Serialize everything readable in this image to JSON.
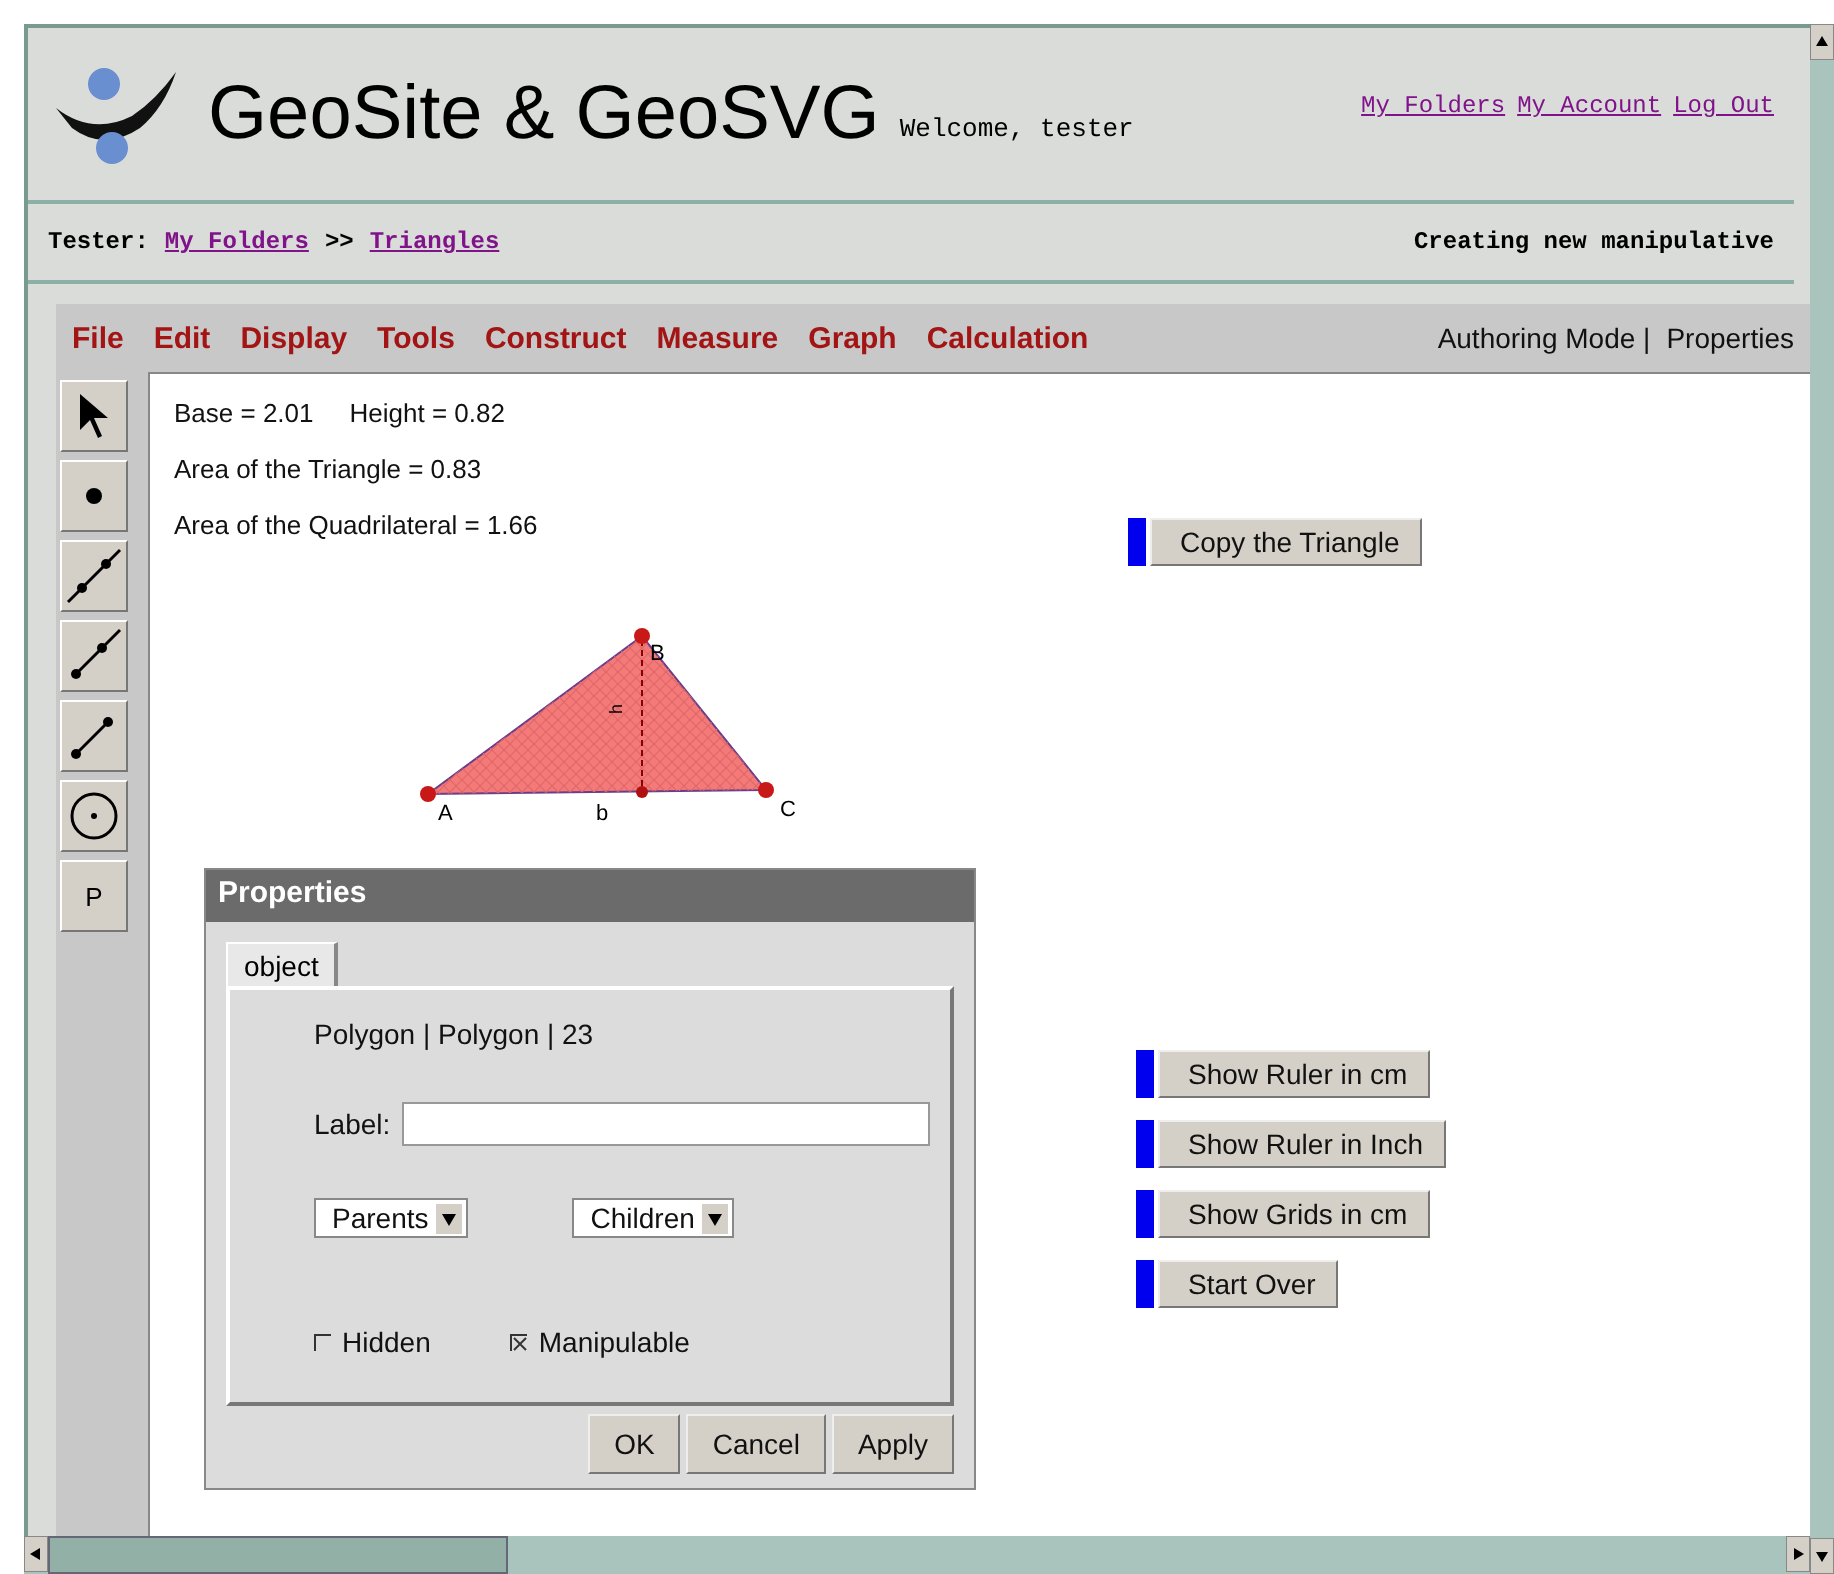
{
  "header": {
    "title": "GeoSite & GeoSVG",
    "welcome": "Welcome, tester",
    "links": [
      "My Folders",
      "My Account",
      "Log Out"
    ]
  },
  "breadcrumb": {
    "label": "Tester:",
    "links": [
      "My Folders",
      "Triangles"
    ],
    "separator": ">>",
    "status": "Creating new manipulative"
  },
  "menu": [
    "File",
    "Edit",
    "Display",
    "Tools",
    "Construct",
    "Measure",
    "Graph",
    "Calculation"
  ],
  "mode_links": [
    "Authoring Mode |",
    "Properties"
  ],
  "tools": [
    {
      "kind": "arrow"
    },
    {
      "kind": "point"
    },
    {
      "kind": "line"
    },
    {
      "kind": "ray"
    },
    {
      "kind": "segment"
    },
    {
      "kind": "circle"
    },
    {
      "kind": "text",
      "label": "P"
    }
  ],
  "measurements": [
    [
      "Base = 2.01",
      "Height = 0.82"
    ],
    [
      "Area of the Triangle = 0.83"
    ],
    [
      "Area of the Quadrilateral = 1.66"
    ]
  ],
  "figure": {
    "vertices": [
      "A",
      "B",
      "C"
    ],
    "side_label": "b",
    "height_label": "h"
  },
  "dialog": {
    "title": "Properties",
    "tabs": [
      {
        "label": "object",
        "selected": true
      }
    ],
    "info": "Polygon | Polygon | 23",
    "label_field": {
      "label": "Label:"
    },
    "dropdowns": [
      "Parents",
      "Children"
    ],
    "checkboxes": [
      {
        "label": "Hidden",
        "checked": false
      },
      {
        "label": "Manipulable",
        "checked": true
      }
    ],
    "buttons": [
      "OK",
      "Cancel",
      "Apply"
    ]
  },
  "action_groups": [
    [
      "Copy the Triangle"
    ],
    [
      "Show Ruler in cm",
      "Show Ruler in Inch",
      "Show Grids in cm",
      "Start Over"
    ]
  ]
}
